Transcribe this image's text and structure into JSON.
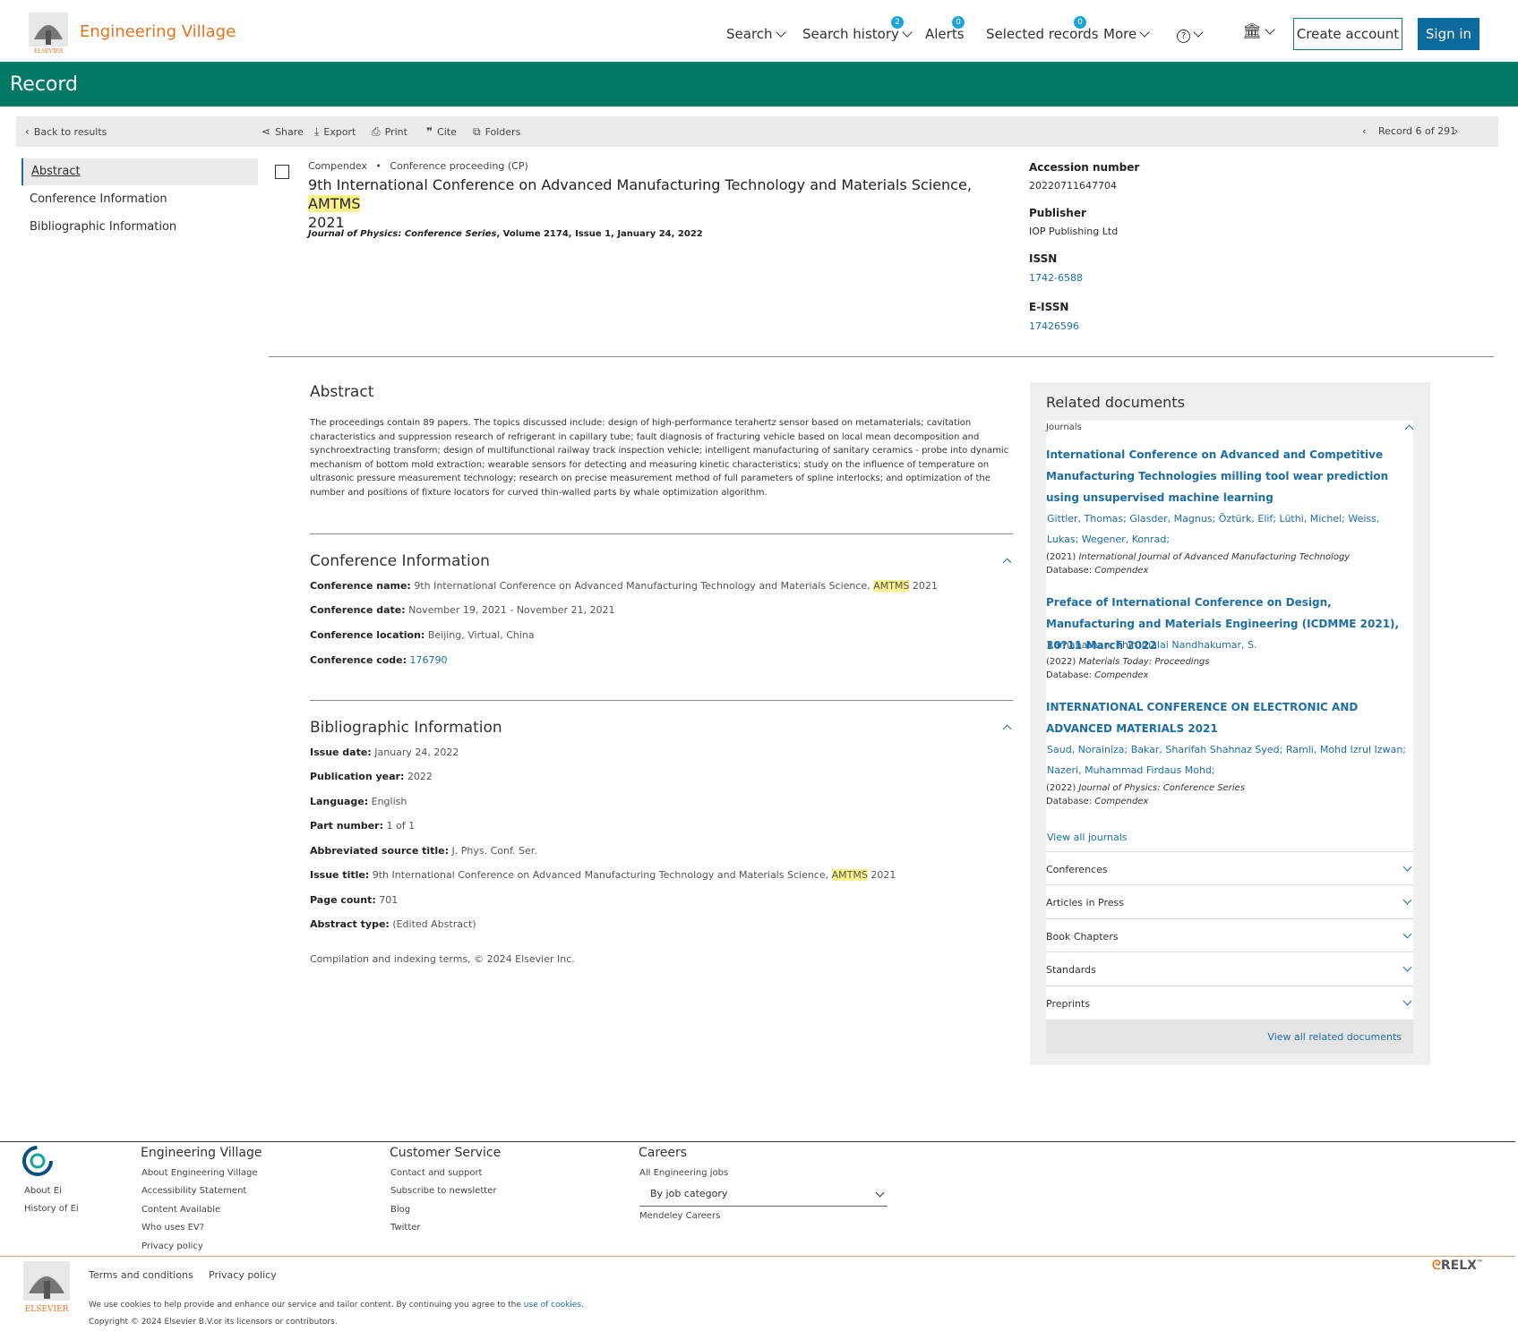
{
  "header": {
    "brand": "Engineering Village",
    "nav": {
      "search": "Search",
      "search_history": "Search history",
      "search_history_badge": "2",
      "alerts": "Alerts",
      "alerts_badge": "0",
      "selected_records": "Selected records",
      "selected_records_badge": "0",
      "more": "More"
    },
    "create_account": "Create account",
    "sign_in": "Sign in"
  },
  "band_title": "Record",
  "toolbar": {
    "back": "Back to results",
    "share": "Share",
    "export": "Export",
    "print": "Print",
    "cite": "Cite",
    "folders": "Folders",
    "record_pos": "Record 6 of 291"
  },
  "leftnav": [
    "Abstract",
    "Conference Information",
    "Bibliographic Information"
  ],
  "record": {
    "database": "Compendex",
    "doctype": "Conference proceeding (CP)",
    "title_main": "9th International Conference on Advanced Manufacturing Technology and Materials Science,",
    "title_hl": "AMTMS",
    "title_year": "2021",
    "source_italic": "Journal of Physics: Conference Series",
    "source_rest": ", Volume 2174, Issue 1, January 24, 2022"
  },
  "meta": {
    "accession_label": "Accession number",
    "accession": "20220711647704",
    "publisher_label": "Publisher",
    "publisher": "IOP Publishing Ltd",
    "issn_label": "ISSN",
    "issn": "1742-6588",
    "eissn_label": "E-ISSN",
    "eissn": "17426596"
  },
  "abstract": {
    "heading": "Abstract",
    "text": "The proceedings contain 89 papers. The topics discussed include: design of high-performance terahertz sensor based on metamaterials; cavitation characteristics and suppression research of refrigerant in capillary tube; fault diagnosis of fracturing vehicle based on local mean decomposition and synchroextracting transform; design of multifunctional railway track inspection vehicle; intelligent manufacturing of sanitary ceramics - probe into dynamic mechanism of bottom mold extraction; wearable sensors for detecting and measuring kinetic characteristics; study on the influence of temperature on ultrasonic pressure measurement technology; research on precise measurement method of full parameters of spline interlocks; and optimization of the number and positions of fixture locators for curved thin-walled parts by whale optimization algorithm."
  },
  "conference": {
    "heading": "Conference Information",
    "name_label": "Conference name:",
    "name": "9th International Conference on Advanced Manufacturing Technology and Materials Science,",
    "name_hl": "AMTMS",
    "name_year": "2021",
    "date_label": "Conference date:",
    "date": "November 19, 2021 - November 21, 2021",
    "location_label": "Conference location:",
    "location": "Beijing, Virtual, China",
    "code_label": "Conference code:",
    "code": "176790"
  },
  "biblio": {
    "heading": "Bibliographic Information",
    "issue_date_label": "Issue date:",
    "issue_date": "January 24, 2022",
    "pub_year_label": "Publication year:",
    "pub_year": "2022",
    "language_label": "Language:",
    "language": "English",
    "part_label": "Part number:",
    "part": "1 of 1",
    "abbr_label": "Abbreviated source title:",
    "abbr": "J. Phys. Conf. Ser.",
    "issue_title_label": "Issue title:",
    "issue_title": "9th International Conference on Advanced Manufacturing Technology and Materials Science,",
    "issue_title_hl": "AMTMS",
    "issue_title_year": "2021",
    "pages_label": "Page count:",
    "pages": "701",
    "abstype_label": "Abstract type:",
    "abstype": "(Edited Abstract)",
    "compilation": "Compilation and indexing terms, © 2024 Elsevier Inc."
  },
  "related": {
    "heading": "Related documents",
    "journals_label": "Journals",
    "items": [
      {
        "title": "International Conference on Advanced and Competitive Manufacturing Technologies milling tool wear prediction using unsupervised machine learning",
        "authors": "Gittler, Thomas; Glasder, Magnus; Öztürk, Elif; Lüthi, Michel; Weiss, Lukas; Wegener, Konrad;",
        "year": "(2021)",
        "journal": "International Journal of Advanced Manufacturing Technology",
        "db_label": "Database:",
        "db": "Compendex"
      },
      {
        "title": "Preface of International Conference on Design, Manufacturing and Materials Engineering (ICDMME 2021), 10?11 March 2022",
        "authors": "Ramanathan, Thirumalai Nandhakumar, S.",
        "year": "(2022)",
        "journal": "Materials Today: Proceedings",
        "db_label": "Database:",
        "db": "Compendex"
      },
      {
        "title": "INTERNATIONAL CONFERENCE ON ELECTRONIC AND ADVANCED MATERIALS 2021",
        "authors": "Saud, Norainiza; Bakar, Sharifah Shahnaz Syed; Ramli, Mohd Izrul Izwan; Nazeri, Muhammad Firdaus Mohd;",
        "year": "(2022)",
        "journal": "Journal of Physics: Conference Series",
        "db_label": "Database:",
        "db": "Compendex"
      }
    ],
    "view_all_journals": "View all journals",
    "sections": [
      "Conferences",
      "Articles in Press",
      "Book Chapters",
      "Standards",
      "Preprints"
    ],
    "view_all": "View all related documents"
  },
  "footer": {
    "about_ei": "About Ei",
    "history_ei": "History of Ei",
    "col1_title": "Engineering Village",
    "col1": [
      "About Engineering Village",
      "Accessibility Statement",
      "Content Available",
      "Who uses EV?",
      "Privacy policy"
    ],
    "col2_title": "Customer Service",
    "col2": [
      "Contact and support",
      "Subscribe to newsletter",
      "Blog",
      "Twitter"
    ],
    "col3_title": "Careers",
    "col3_jobs": "All Engineering jobs",
    "col3_select": "By job category",
    "col3_mendeley": "Mendeley Careers",
    "terms": "Terms and conditions",
    "privacy": "Privacy policy",
    "cookie_text": "We use cookies to help provide and enhance our service and tailor content. By continuing you agree to the",
    "cookie_link": "use of cookies",
    "copyright": "Copyright © 2024 Elsevier B.V.or its licensors or contributors.",
    "elsevier": "ELSEVIER",
    "relx": "RELX"
  },
  "colors": {
    "band": "#007a66",
    "link": "#1e6ea6",
    "brand": "#e9711c",
    "highlight": "#fbf28a"
  }
}
